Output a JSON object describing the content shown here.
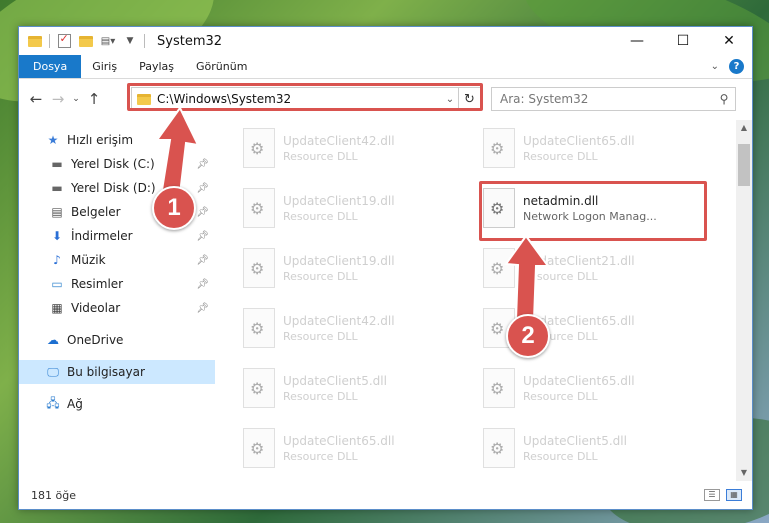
{
  "window": {
    "title": "System32",
    "controls": [
      "minimize-icon",
      "maximize-icon",
      "close-icon"
    ]
  },
  "ribbon": {
    "tabs": [
      {
        "label": "Dosya"
      },
      {
        "label": "Giriş"
      },
      {
        "label": "Paylaş"
      },
      {
        "label": "Görünüm"
      }
    ]
  },
  "address": {
    "path": "C:\\Windows\\System32",
    "search_placeholder": "Ara: System32"
  },
  "sidebar": {
    "quick_access": "Hızlı erişim",
    "items": [
      {
        "label": "Yerel Disk (C:)",
        "icon": "drive-icon"
      },
      {
        "label": "Yerel Disk (D:)",
        "icon": "drive-icon"
      },
      {
        "label": "Belgeler",
        "icon": "documents-icon"
      },
      {
        "label": "İndirmeler",
        "icon": "download-icon"
      },
      {
        "label": "Müzik",
        "icon": "music-icon"
      },
      {
        "label": "Resimler",
        "icon": "pictures-icon"
      },
      {
        "label": "Videolar",
        "icon": "video-icon"
      }
    ],
    "onedrive": "OneDrive",
    "this_pc": "Bu bilgisayar",
    "network": "Ağ"
  },
  "files": [
    {
      "name": "UpdateClient42.dll",
      "type": "Resource DLL"
    },
    {
      "name": "UpdateClient65.dll",
      "type": "Resource DLL"
    },
    {
      "name": "UpdateClient19.dll",
      "type": "Resource DLL"
    },
    {
      "name": "netadmin.dll",
      "type": "Network Logon Manag..."
    },
    {
      "name": "UpdateClient19.dll",
      "type": "Resource DLL"
    },
    {
      "name": "UpdateClient21.dll",
      "type": "Resource DLL"
    },
    {
      "name": "UpdateClient42.dll",
      "type": "Resource DLL"
    },
    {
      "name": "UpdateClient65.dll",
      "type": "Resource DLL"
    },
    {
      "name": "UpdateClient5.dll",
      "type": "Resource DLL"
    },
    {
      "name": "UpdateClient65.dll",
      "type": "Resource DLL"
    },
    {
      "name": "UpdateClient65.dll",
      "type": "Resource DLL"
    },
    {
      "name": "UpdateClient5.dll",
      "type": "Resource DLL"
    }
  ],
  "status": {
    "count": "181 öğe"
  },
  "annotations": {
    "step1": "1",
    "step2": "2",
    "color": "#d9534f"
  }
}
